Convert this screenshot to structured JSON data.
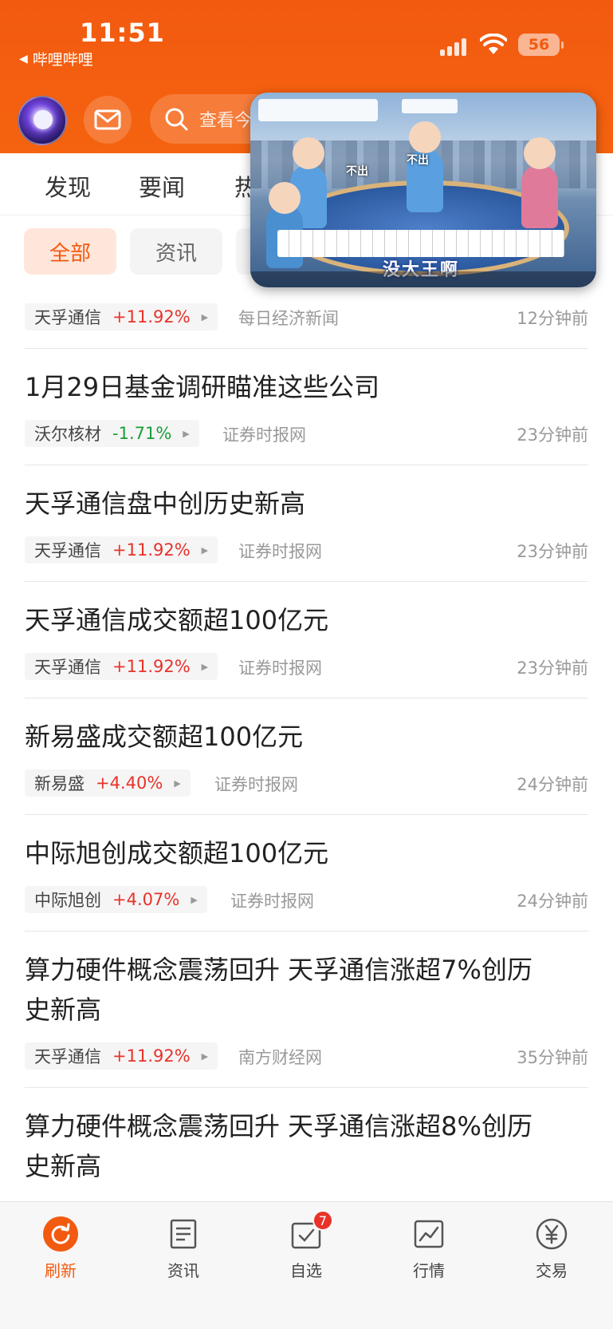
{
  "status_bar": {
    "time": "11:51",
    "back_app": "哔哩哔哩",
    "battery": "56"
  },
  "header": {
    "search_placeholder": "查看今"
  },
  "pip": {
    "caption": "没大王啊",
    "bubble_left": "不出",
    "bubble_center": "不出"
  },
  "tabs": [
    "发现",
    "要闻",
    "热"
  ],
  "filters": [
    "全部",
    "资讯"
  ],
  "news": [
    {
      "title": "",
      "stock": "天孚通信",
      "change": "+11.92%",
      "dir": "up",
      "source": "每日经济新闻",
      "time": "12分钟前"
    },
    {
      "title": "1月29日基金调研瞄准这些公司",
      "stock": "沃尔核材",
      "change": "-1.71%",
      "dir": "down",
      "source": "证券时报网",
      "time": "23分钟前"
    },
    {
      "title": "天孚通信盘中创历史新高",
      "stock": "天孚通信",
      "change": "+11.92%",
      "dir": "up",
      "source": "证券时报网",
      "time": "23分钟前"
    },
    {
      "title": "天孚通信成交额超100亿元",
      "stock": "天孚通信",
      "change": "+11.92%",
      "dir": "up",
      "source": "证券时报网",
      "time": "23分钟前"
    },
    {
      "title": "新易盛成交额超100亿元",
      "stock": "新易盛",
      "change": "+4.40%",
      "dir": "up",
      "source": "证券时报网",
      "time": "24分钟前"
    },
    {
      "title": "中际旭创成交额超100亿元",
      "stock": "中际旭创",
      "change": "+4.07%",
      "dir": "up",
      "source": "证券时报网",
      "time": "24分钟前"
    },
    {
      "title_line1": "算力硬件概念震荡回升 天孚通信涨超7%创历",
      "title_line2": "史新高",
      "stock": "天孚通信",
      "change": "+11.92%",
      "dir": "up",
      "source": "南方财经网",
      "time": "35分钟前"
    },
    {
      "title_line1": "算力硬件概念震荡回升 天孚通信涨超8%创历",
      "title_line2": "史新高"
    }
  ],
  "bottom_nav": [
    {
      "label": "刷新",
      "icon": "refresh-icon",
      "active": true
    },
    {
      "label": "资讯",
      "icon": "news-icon",
      "active": false
    },
    {
      "label": "自选",
      "icon": "watchlist-icon",
      "active": false,
      "badge": "7"
    },
    {
      "label": "行情",
      "icon": "market-chart-icon",
      "active": false
    },
    {
      "label": "交易",
      "icon": "yen-trade-icon",
      "active": false
    }
  ],
  "colors": {
    "brand": "#f25a10",
    "up": "#e8322a",
    "down": "#1a9e3a"
  }
}
